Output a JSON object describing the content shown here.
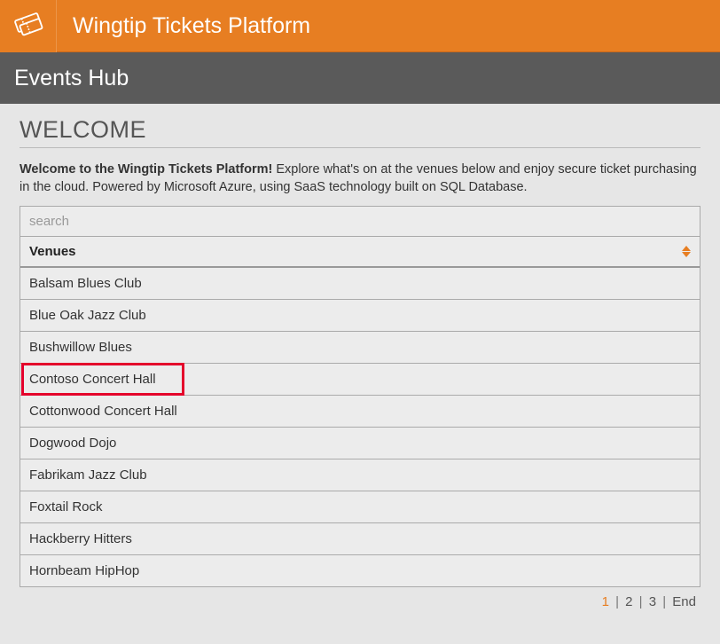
{
  "header": {
    "app_title": "Wingtip Tickets Platform"
  },
  "subheader": {
    "title": "Events Hub"
  },
  "main": {
    "welcome_heading": "WELCOME",
    "intro_bold": "Welcome to the Wingtip Tickets Platform!",
    "intro_rest": " Explore what's on at the venues below and enjoy secure ticket purchasing in the cloud. Powered by Microsoft Azure, using SaaS technology built on SQL Database.",
    "search_placeholder": "search",
    "table_header": "Venues",
    "venues": [
      "Balsam Blues Club",
      "Blue Oak Jazz Club",
      "Bushwillow Blues",
      "Contoso Concert Hall",
      "Cottonwood Concert Hall",
      "Dogwood Dojo",
      "Fabrikam Jazz Club",
      "Foxtail Rock",
      "Hackberry Hitters",
      "Hornbeam HipHop"
    ],
    "highlighted_index": 3
  },
  "pagination": {
    "pages": [
      "1",
      "2",
      "3",
      "End"
    ],
    "current": "1",
    "separator": "|"
  }
}
